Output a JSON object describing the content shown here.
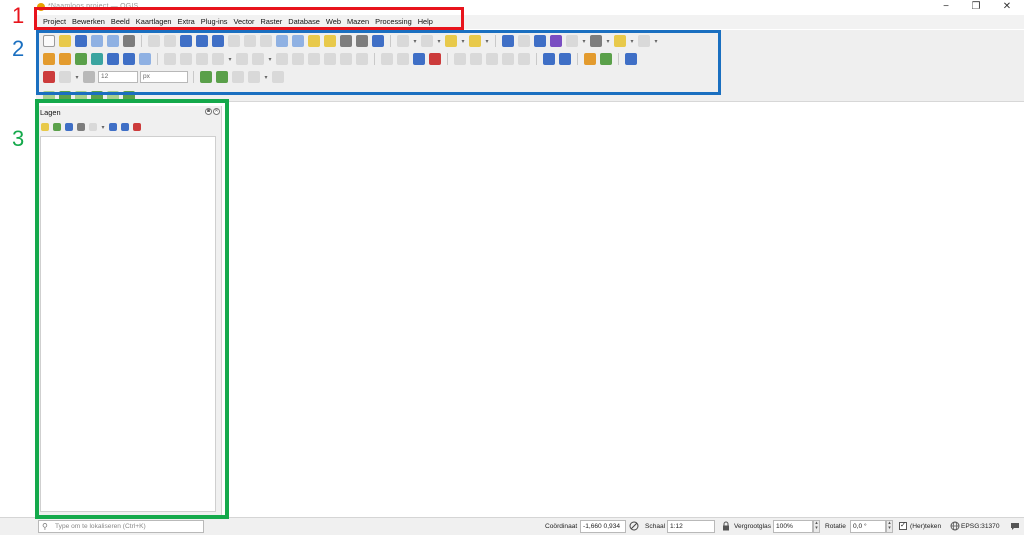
{
  "window": {
    "title": "*Naamloos project — QGIS",
    "controls": {
      "minimize": "−",
      "maximize": "❐",
      "close": "✕"
    }
  },
  "menubar": {
    "items": [
      "Project",
      "Bewerken",
      "Beeld",
      "Kaartlagen",
      "Extra",
      "Plug-ins",
      "Vector",
      "Raster",
      "Database",
      "Web",
      "Mazen",
      "Processing",
      "Help"
    ]
  },
  "toolbars": {
    "font_size_value": "12",
    "unit_value": "px"
  },
  "layers_panel": {
    "title": "Lagen",
    "controls": [
      "◙",
      "✕"
    ]
  },
  "statusbar": {
    "locator_placeholder": "Type om te lokaliseren (Ctrl+K)",
    "coordinate_label": "Coördinaat",
    "coordinate_value": "-1,660 0,934",
    "scale_label": "Schaal",
    "scale_value": "1:12",
    "magnifier_label": "Vergrootglas",
    "magnifier_value": "100%",
    "rotation_label": "Rotatie",
    "rotation_value": "0,0 °",
    "render_label": "(Her)teken",
    "crs_label": "EPSG:31370"
  },
  "annotations": [
    {
      "number": "1",
      "color": "#e8141c"
    },
    {
      "number": "2",
      "color": "#1a6fc0"
    },
    {
      "number": "3",
      "color": "#14a94b"
    }
  ]
}
